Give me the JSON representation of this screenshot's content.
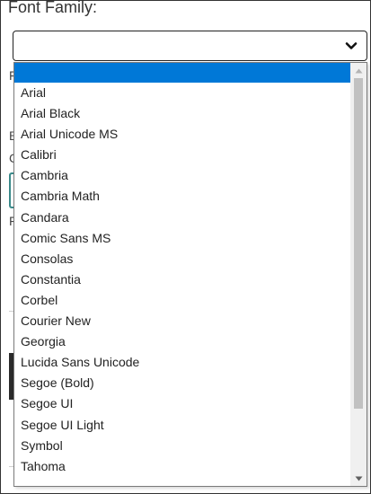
{
  "field": {
    "label": "Font Family:",
    "value": ""
  },
  "background_fragments": {
    "letters": [
      "F",
      "B",
      "C",
      "F"
    ]
  },
  "dropdown": {
    "selected_index": 0,
    "options": [
      "",
      "Arial",
      "Arial Black",
      "Arial Unicode MS",
      "Calibri",
      "Cambria",
      "Cambria Math",
      "Candara",
      "Comic Sans MS",
      "Consolas",
      "Constantia",
      "Corbel",
      "Courier New",
      "Georgia",
      "Lucida Sans Unicode",
      "Segoe (Bold)",
      "Segoe UI",
      "Segoe UI Light",
      "Symbol",
      "Tahoma"
    ]
  },
  "colors": {
    "selection": "#0078d7",
    "scroll_thumb": "#c1c1c1",
    "scroll_track": "#f0f0f0"
  },
  "icons": {
    "select_chevron": "chevron-down-icon",
    "scroll_up": "scroll-up-arrow-icon",
    "scroll_down": "scroll-down-arrow-icon"
  }
}
